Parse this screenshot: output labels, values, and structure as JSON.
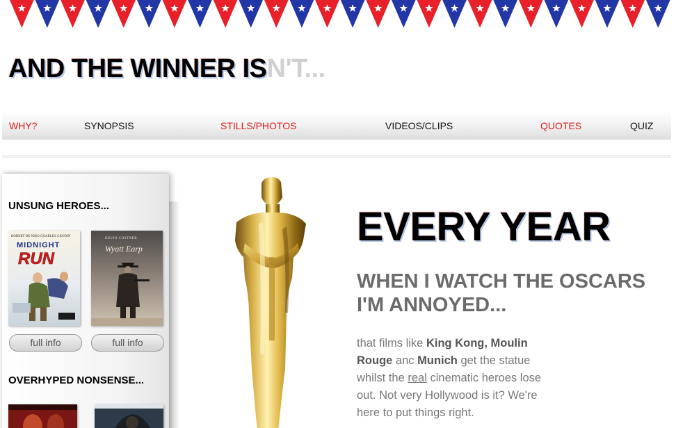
{
  "bunting": {
    "colors": {
      "red": "#e8202a",
      "blue": "#2236a6",
      "star": "#ffffff"
    },
    "pennant_pattern": [
      "red",
      "blue"
    ],
    "star_icon": "star-icon"
  },
  "site": {
    "title_main": "AND THE WINNER IS",
    "title_faded": "N'T..."
  },
  "nav": {
    "items": [
      {
        "label": "WHY?",
        "color": "#e01b1b"
      },
      {
        "label": "SYNOPSIS",
        "color": "#111111"
      },
      {
        "label": "STILLS/PHOTOS",
        "color": "#e01b1b"
      },
      {
        "label": "VIDEOS/CLIPS",
        "color": "#111111"
      },
      {
        "label": "QUOTES",
        "color": "#e01b1b"
      },
      {
        "label": "QUIZ",
        "color": "#111111"
      }
    ]
  },
  "sidebar": {
    "section1": {
      "heading": "UNSUNG HEROES...",
      "movies": [
        {
          "cover_credits": "ROBERT DE NIRO   CHARLES GRODIN",
          "cover_title_top": "MIDNIGHT",
          "cover_title_bottom": "RUN",
          "button": "full info"
        },
        {
          "cover_credits": "KEVIN COSTNER",
          "cover_title": "Wyatt Earp",
          "button": "full info"
        }
      ]
    },
    "section2": {
      "heading": "OVERHYPED NONSENSE..."
    }
  },
  "hero": {
    "heading": "EVERY YEAR",
    "subheading": "WHEN I WATCH THE OSCARS I'M ANNOYED...",
    "body": {
      "t1": "that films like ",
      "b1": "King Kong, Moulin Rouge",
      "t2": " anc ",
      "b2": "Munich",
      "t3": " get the statue whilst the ",
      "u1": "real",
      "t4": " cinematic heroes lose out. Not very Hollywood is it? We're here to put things right."
    }
  }
}
